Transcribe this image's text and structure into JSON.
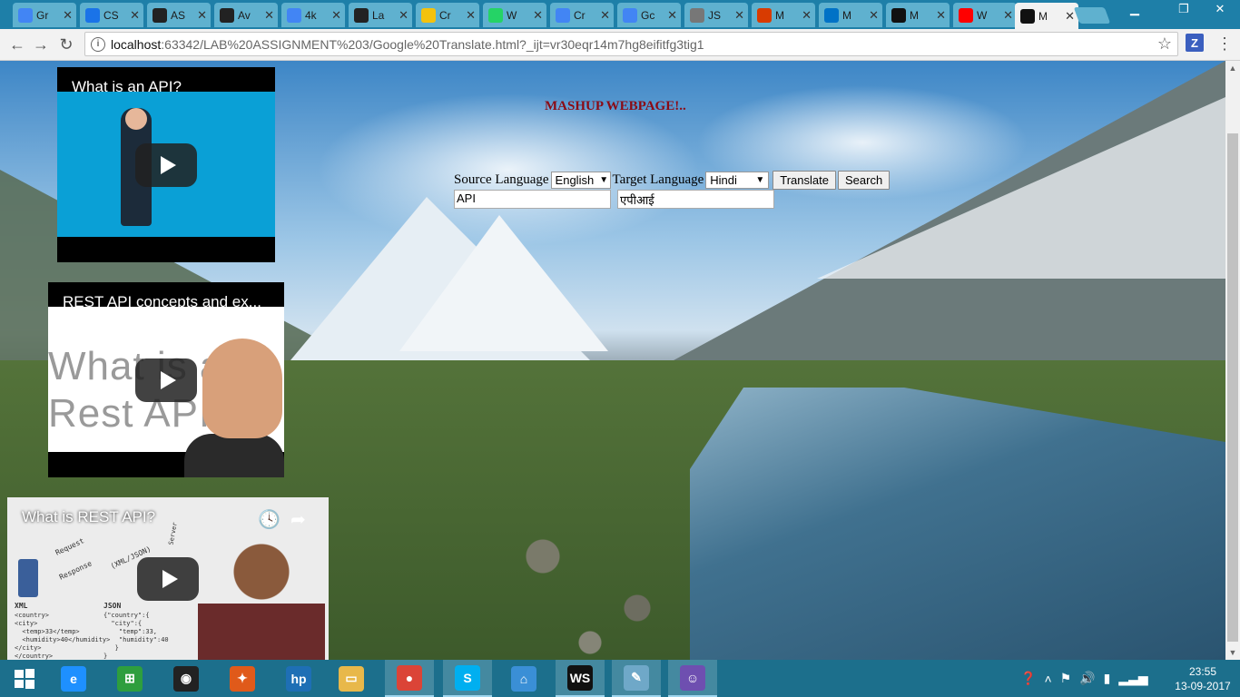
{
  "browser": {
    "tabs": [
      {
        "label": "Gr",
        "favicon": "google-icon",
        "color": "#4285f4"
      },
      {
        "label": "CS",
        "favicon": "box-icon",
        "color": "#1a73e8"
      },
      {
        "label": "AS",
        "favicon": "github-icon",
        "color": "#222222"
      },
      {
        "label": "Av",
        "favicon": "github-icon",
        "color": "#222222"
      },
      {
        "label": "4k",
        "favicon": "google-icon",
        "color": "#4285f4"
      },
      {
        "label": "La",
        "favicon": "github-icon",
        "color": "#222222"
      },
      {
        "label": "Cr",
        "favicon": "bulb-icon",
        "color": "#f4c20d"
      },
      {
        "label": "W",
        "favicon": "whatsapp-icon",
        "color": "#25d366"
      },
      {
        "label": "Cr",
        "favicon": "google-icon",
        "color": "#4285f4"
      },
      {
        "label": "Gc",
        "favicon": "google-icon",
        "color": "#4285f4"
      },
      {
        "label": "JS",
        "favicon": "json-icon",
        "color": "#777777"
      },
      {
        "label": "M",
        "favicon": "office-icon",
        "color": "#d83b01"
      },
      {
        "label": "M",
        "favicon": "outlook-icon",
        "color": "#0072c6"
      },
      {
        "label": "M",
        "favicon": "webstorm-icon",
        "color": "#111111"
      },
      {
        "label": "W",
        "favicon": "youtube-icon",
        "color": "#ff0000"
      },
      {
        "label": "M",
        "favicon": "webstorm-icon",
        "color": "#111111"
      }
    ],
    "active_tab_index": 15,
    "url_host": "localhost",
    "url_rest": ":63342/LAB%20ASSIGNMENT%203/Google%20Translate.html?_ijt=vr30eqr14m7hg8eifitfg3tig1",
    "extension_label": "Z"
  },
  "page": {
    "heading": "MASHUP WEBPAGE!..",
    "source_label": "Source Language",
    "source_language": "English",
    "target_label": "Target Language",
    "target_language": "Hindi",
    "translate_button": "Translate",
    "search_button": "Search",
    "source_text": "API",
    "translated_text": "एपीआई"
  },
  "videos": [
    {
      "title": "What is an API?"
    },
    {
      "title": "REST API concepts and ex...",
      "thumb_text_1": "What is a",
      "thumb_text_2": "Rest API?"
    },
    {
      "title": "What is REST API?",
      "label_request": "Request",
      "label_response": "Response",
      "label_format": "(XML/JSON)",
      "label_server": "Server",
      "label_xml": "XML",
      "label_json": "JSON",
      "code_xml": "<country>\n<city>\n  <temp>33</temp>\n  <humidity>40</humidity>\n</city>\n</country>",
      "code_json": "{\"country\":{\n  \"city\":{\n    \"temp\":33,\n    \"humidity\":40\n   }\n}"
    }
  ],
  "taskbar": {
    "apps": [
      {
        "name": "ie-icon",
        "label": "e",
        "color": "#1e90ff"
      },
      {
        "name": "store-icon",
        "label": "⊞",
        "color": "#2e9e3e"
      },
      {
        "name": "camera-icon",
        "label": "◉",
        "color": "#222222"
      },
      {
        "name": "puzzle-icon",
        "label": "✦",
        "color": "#e05a1a"
      },
      {
        "name": "hp-icon",
        "label": "hp",
        "color": "#1e6fb5"
      },
      {
        "name": "folder-icon",
        "label": "▭",
        "color": "#e8b84a"
      },
      {
        "name": "chrome-icon",
        "label": "●",
        "color": "#db4437"
      },
      {
        "name": "skype-icon",
        "label": "S",
        "color": "#00aff0"
      },
      {
        "name": "home-icon",
        "label": "⌂",
        "color": "#3a8fd6"
      },
      {
        "name": "webstorm-icon",
        "label": "WS",
        "color": "#111111"
      },
      {
        "name": "notepad-icon",
        "label": "✎",
        "color": "#6fa8c8"
      },
      {
        "name": "github-desktop-icon",
        "label": "☺",
        "color": "#6e4fb0"
      }
    ],
    "time": "23:55",
    "date": "13-09-2017"
  }
}
